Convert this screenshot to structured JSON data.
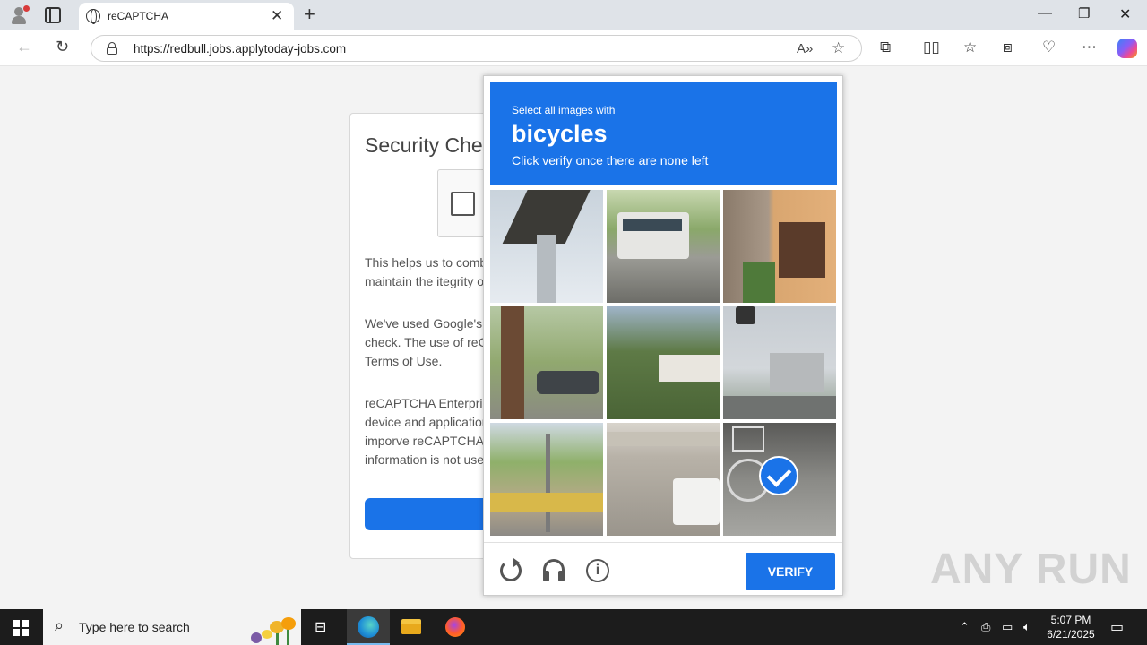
{
  "browser": {
    "tab_title": "reCAPTCHA",
    "url": "https://redbull.jobs.applytoday-jobs.com"
  },
  "card": {
    "title": "Security Chec",
    "para1": [
      "This helps us to comba",
      "maintain the itegrity of"
    ],
    "para2": [
      "We've used Google's r",
      "check. The use of reC/",
      "Terms of Use."
    ],
    "para3": [
      "reCAPTCHA Enterpris",
      "device and application",
      "imporve reCAPTCHA",
      "information is not used"
    ]
  },
  "captcha": {
    "select_label": "Select all images with",
    "target": "bicycles",
    "hint": "Click verify once there are none left",
    "verify_label": "VERIFY",
    "info_glyph": "i",
    "tiles": [
      {
        "desc": "pole-overpass",
        "selected": false
      },
      {
        "desc": "bus-road",
        "selected": false
      },
      {
        "desc": "building-window",
        "selected": false
      },
      {
        "desc": "tree-cars",
        "selected": false
      },
      {
        "desc": "bushes-hill",
        "selected": false
      },
      {
        "desc": "traffic-light-city",
        "selected": false
      },
      {
        "desc": "street-umbrellas",
        "selected": false
      },
      {
        "desc": "bus-underpass",
        "selected": false
      },
      {
        "desc": "bicycle",
        "selected": true
      }
    ]
  },
  "watermark": "ANY RUN",
  "taskbar": {
    "search_placeholder": "Type here to search",
    "time": "5:07 PM",
    "date": "6/21/2025"
  },
  "colors": {
    "accent": "#1a73e8",
    "taskbar": "#1c1c1c"
  }
}
